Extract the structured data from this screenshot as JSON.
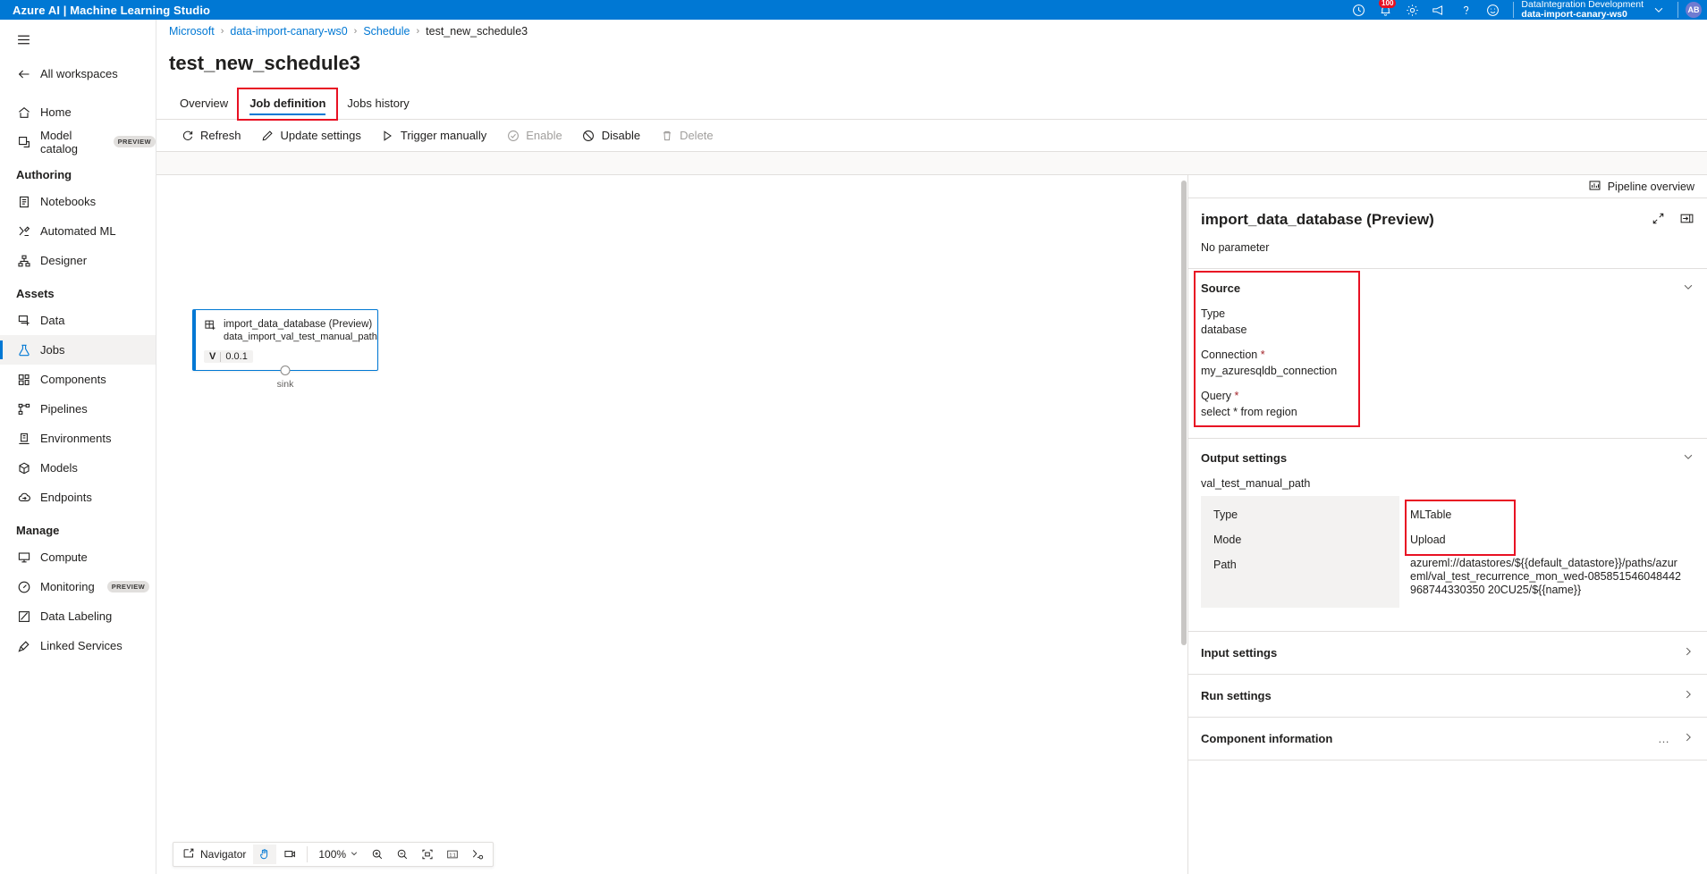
{
  "topbar": {
    "brand": "Azure AI | Machine Learning Studio",
    "icons": [
      {
        "name": "clock-icon",
        "label": "Recent"
      },
      {
        "name": "bell-icon",
        "label": "Notifications",
        "badge": "100"
      },
      {
        "name": "gear-icon",
        "label": "Settings"
      },
      {
        "name": "megaphone-icon",
        "label": "Feedback"
      },
      {
        "name": "question-icon",
        "label": "Help"
      },
      {
        "name": "smiley-icon",
        "label": "Smiley feedback"
      }
    ],
    "account": {
      "directory": "DataIntegration Development",
      "workspace": "data-import-canary-ws0",
      "initials": "AB"
    }
  },
  "sidebar": {
    "back_label": "All workspaces",
    "items": [
      {
        "label": "Home",
        "icon": "home-icon",
        "key": "home"
      },
      {
        "label": "Model catalog",
        "icon": "model-catalog-icon",
        "key": "model-catalog",
        "pill": "PREVIEW"
      }
    ],
    "groups": [
      {
        "title": "Authoring",
        "items": [
          {
            "label": "Notebooks",
            "icon": "notebook-icon",
            "key": "notebooks"
          },
          {
            "label": "Automated ML",
            "icon": "automated-ml-icon",
            "key": "automated-ml"
          },
          {
            "label": "Designer",
            "icon": "designer-icon",
            "key": "designer"
          }
        ]
      },
      {
        "title": "Assets",
        "items": [
          {
            "label": "Data",
            "icon": "data-icon",
            "key": "data"
          },
          {
            "label": "Jobs",
            "icon": "jobs-icon",
            "key": "jobs",
            "selected": true
          },
          {
            "label": "Components",
            "icon": "components-icon",
            "key": "components"
          },
          {
            "label": "Pipelines",
            "icon": "pipelines-icon",
            "key": "pipelines"
          },
          {
            "label": "Environments",
            "icon": "environments-icon",
            "key": "environments"
          },
          {
            "label": "Models",
            "icon": "models-icon",
            "key": "models"
          },
          {
            "label": "Endpoints",
            "icon": "endpoints-icon",
            "key": "endpoints"
          }
        ]
      },
      {
        "title": "Manage",
        "items": [
          {
            "label": "Compute",
            "icon": "compute-icon",
            "key": "compute"
          },
          {
            "label": "Monitoring",
            "icon": "monitoring-icon",
            "key": "monitoring",
            "pill": "PREVIEW"
          },
          {
            "label": "Data Labeling",
            "icon": "data-labeling-icon",
            "key": "data-labeling"
          },
          {
            "label": "Linked Services",
            "icon": "linked-services-icon",
            "key": "linked-services"
          }
        ]
      }
    ]
  },
  "breadcrumb": [
    {
      "label": "Microsoft",
      "link": true
    },
    {
      "label": "data-import-canary-ws0",
      "link": true
    },
    {
      "label": "Schedule",
      "link": true
    },
    {
      "label": "test_new_schedule3",
      "link": false
    }
  ],
  "page": {
    "title": "test_new_schedule3",
    "tabs": [
      {
        "label": "Overview",
        "active": false
      },
      {
        "label": "Job definition",
        "active": true,
        "annotated": true
      },
      {
        "label": "Jobs history",
        "active": false
      }
    ]
  },
  "commandbar": [
    {
      "label": "Refresh",
      "icon": "refresh-icon",
      "disabled": false
    },
    {
      "label": "Update settings",
      "icon": "pencil-icon",
      "disabled": false
    },
    {
      "label": "Trigger manually",
      "icon": "play-icon",
      "disabled": false
    },
    {
      "label": "Enable",
      "icon": "check-circle-icon",
      "disabled": true
    },
    {
      "label": "Disable",
      "icon": "block-icon",
      "disabled": false
    },
    {
      "label": "Delete",
      "icon": "trash-icon",
      "disabled": true
    }
  ],
  "canvas": {
    "node": {
      "title": "import_data_database (Preview)",
      "subtitle": "data_import_val_test_manual_path",
      "version_label": "V",
      "version": "0.0.1",
      "port_label": "sink"
    },
    "navigator": {
      "label": "Navigator",
      "tools": [
        "pan-hand-icon",
        "screenshot-icon"
      ],
      "zoom": "100%",
      "buttons": [
        "zoom-in-icon",
        "zoom-out-icon",
        "fit-screen-icon",
        "actual-size-icon",
        "auto-layout-icon"
      ],
      "actual_size_label": "1:1"
    }
  },
  "rightpanel": {
    "pipeline_overview": "Pipeline overview",
    "title": "import_data_database (Preview)",
    "no_parameter": "No parameter",
    "header_icons": [
      "expand-icon",
      "dock-right-icon"
    ],
    "source": {
      "heading": "Source",
      "fields": [
        {
          "label": "Type",
          "required": false,
          "value": "database"
        },
        {
          "label": "Connection",
          "required": true,
          "value": "my_azuresqldb_connection"
        },
        {
          "label": "Query",
          "required": true,
          "value": "select * from region"
        }
      ]
    },
    "output_settings": {
      "heading": "Output settings",
      "output_name": "val_test_manual_path",
      "rows": [
        {
          "key": "Type",
          "value": "MLTable"
        },
        {
          "key": "Mode",
          "value": "Upload"
        },
        {
          "key": "Path",
          "value": "azureml://datastores/${{default_datastore}}/paths/azureml/val_test_recurrence_mon_wed-085851546048442968744330350 20CU25/${{name}}"
        }
      ]
    },
    "collapsed_sections": [
      {
        "label": "Input settings",
        "more": false
      },
      {
        "label": "Run settings",
        "more": false
      },
      {
        "label": "Component information",
        "more": true
      }
    ]
  },
  "colors": {
    "brand_blue": "#0078d4",
    "annotation_red": "#e81123",
    "required_red": "#a4262c",
    "panel_grey": "#f3f2f1"
  }
}
